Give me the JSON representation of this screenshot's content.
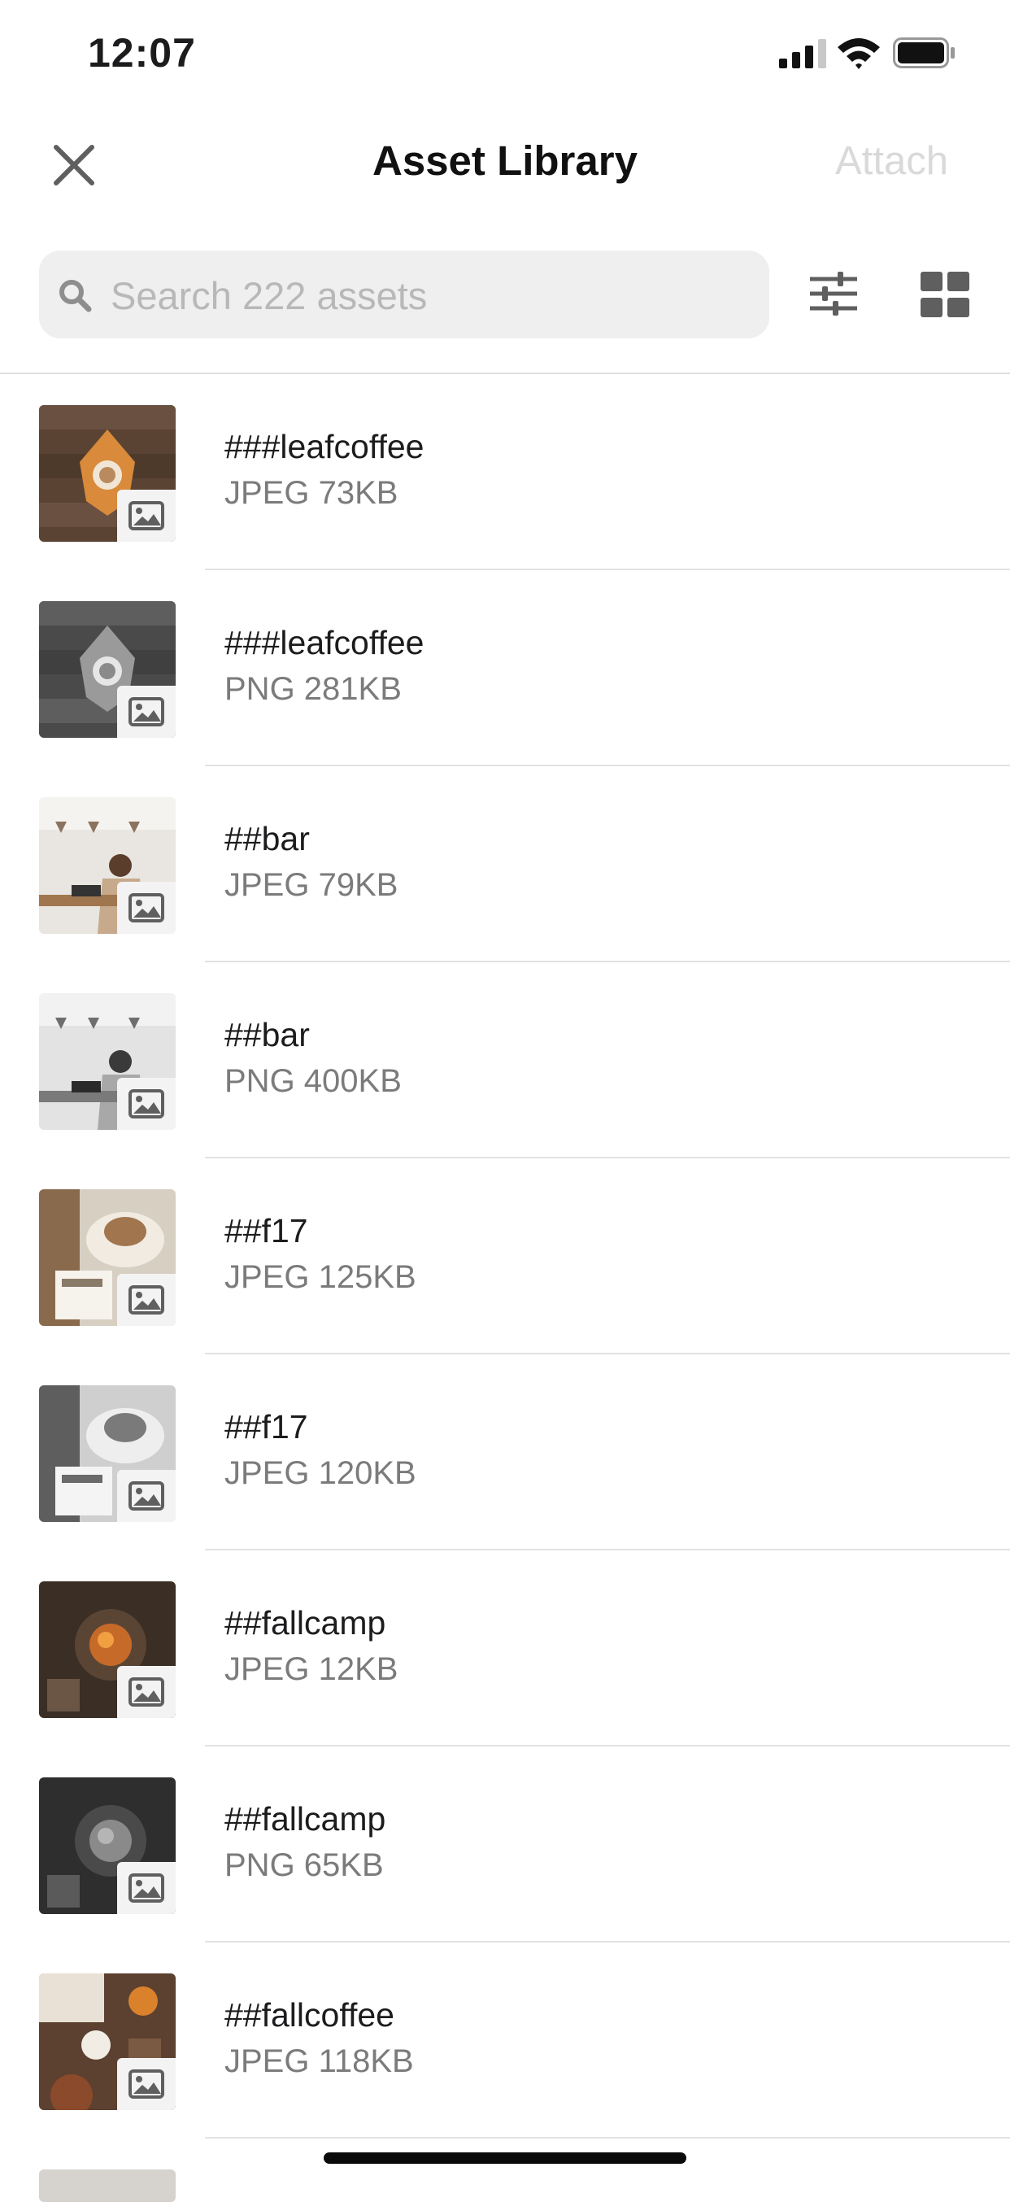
{
  "status_bar": {
    "time": "12:07"
  },
  "nav": {
    "title": "Asset Library",
    "attach_label": "Attach"
  },
  "search": {
    "placeholder": "Search 222 assets",
    "value": ""
  },
  "assets": [
    {
      "name": "###leafcoffee",
      "meta": "JPEG 73KB"
    },
    {
      "name": "###leafcoffee",
      "meta": "PNG 281KB"
    },
    {
      "name": "##bar",
      "meta": "JPEG 79KB"
    },
    {
      "name": "##bar",
      "meta": "PNG 400KB"
    },
    {
      "name": "##f17",
      "meta": "JPEG 125KB"
    },
    {
      "name": "##f17",
      "meta": "JPEG 120KB"
    },
    {
      "name": "##fallcamp",
      "meta": "JPEG 12KB"
    },
    {
      "name": "##fallcamp",
      "meta": "PNG 65KB"
    },
    {
      "name": "##fallcoffee",
      "meta": "JPEG 118KB"
    }
  ],
  "icons": {
    "close": "close-icon",
    "search": "search-icon",
    "filter": "sliders-icon",
    "grid": "grid-view-icon",
    "asset_type": "image-icon"
  },
  "colors": {
    "attach_disabled": "#d9d9d9",
    "search_bg": "#efefef",
    "secondary_text": "#7b7b7b"
  }
}
